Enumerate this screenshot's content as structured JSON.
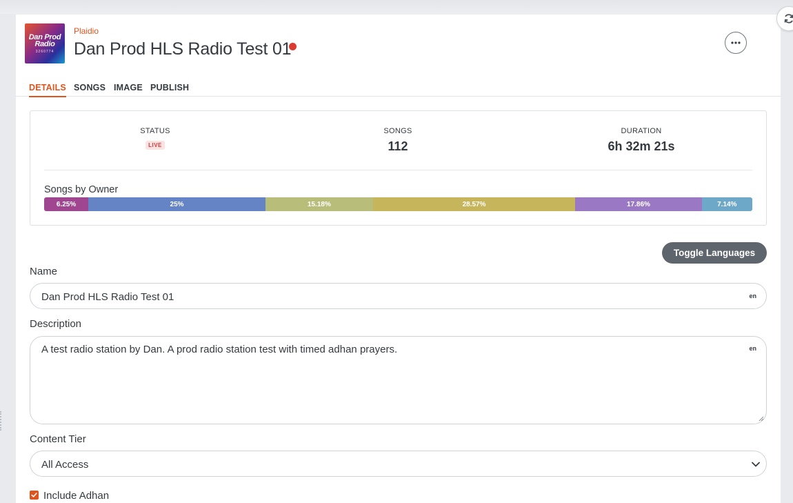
{
  "header": {
    "owner": "Plaidio",
    "title": "Dan Prod HLS Radio Test 01",
    "cover": {
      "line1": "Dan Prod",
      "line2": "Radio",
      "line3": "3260774"
    }
  },
  "tabs": [
    {
      "label": "DETAILS",
      "active": true
    },
    {
      "label": "SONGS",
      "active": false
    },
    {
      "label": "IMAGE",
      "active": false
    },
    {
      "label": "PUBLISH",
      "active": false
    }
  ],
  "stats": {
    "status": {
      "label": "STATUS",
      "badge": "LIVE"
    },
    "songs": {
      "label": "SONGS",
      "value": "112"
    },
    "duration": {
      "label": "DURATION",
      "value": "6h 32m 21s"
    }
  },
  "songs_by_owner": {
    "heading": "Songs by Owner",
    "segments": [
      {
        "label": "6.25%",
        "percent": 6.25,
        "color": "#a0458f"
      },
      {
        "label": "25%",
        "percent": 25,
        "color": "#6584c6"
      },
      {
        "label": "15.18%",
        "percent": 15.18,
        "color": "#b9bd7a"
      },
      {
        "label": "28.57%",
        "percent": 28.57,
        "color": "#c6b55b"
      },
      {
        "label": "17.86%",
        "percent": 17.86,
        "color": "#9a78c3"
      },
      {
        "label": "7.14%",
        "percent": 7.14,
        "color": "#6ea8c9"
      }
    ]
  },
  "toggle_languages_label": "Toggle Languages",
  "form": {
    "name": {
      "label": "Name",
      "value": "Dan Prod HLS Radio Test 01",
      "lang": "en"
    },
    "description": {
      "label": "Description",
      "value": "A test radio station by Dan. A prod radio station test with timed adhan prayers.",
      "lang": "en"
    },
    "content_tier": {
      "label": "Content Tier",
      "value": "All Access"
    },
    "include_adhan": {
      "label": "Include Adhan",
      "checked": true
    }
  },
  "colors": {
    "accent": "#e0531c",
    "live_dot": "#dc3b2f",
    "button_dark": "#5f656c"
  },
  "icons": {
    "refresh": "refresh-icon",
    "more": "more-horizontal-icon",
    "chevron": "chevron-down-icon",
    "check": "check-icon"
  }
}
